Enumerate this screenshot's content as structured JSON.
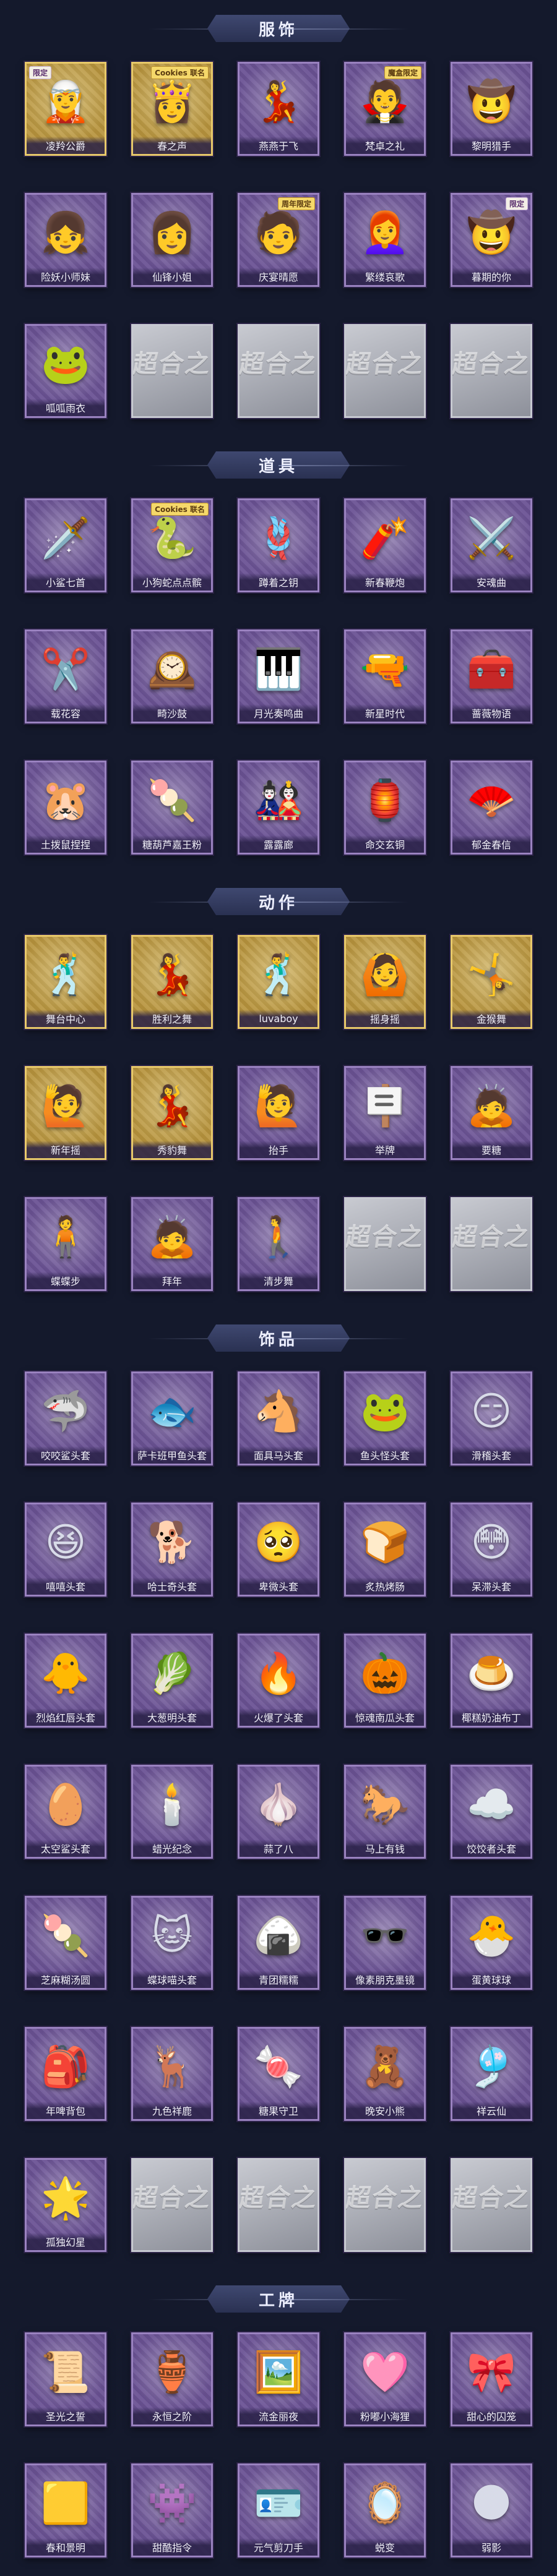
{
  "sections": [
    {
      "title": "服饰",
      "items": [
        {
          "label": "凌羚公爵",
          "icon": "costume-portrait",
          "glyph": "🧝",
          "tier": "gold",
          "badge": "限定"
        },
        {
          "label": "春之声",
          "icon": "costume-portrait",
          "glyph": "👸",
          "tier": "gold",
          "badge": "Cookies\n联名"
        },
        {
          "label": "燕燕于飞",
          "icon": "costume-portrait",
          "glyph": "💃",
          "tier": "purple"
        },
        {
          "label": "梵卓之礼",
          "icon": "costume-portrait",
          "glyph": "🧛",
          "tier": "purple",
          "badge": "魔盒限定"
        },
        {
          "label": "黎明猎手",
          "icon": "costume-portrait",
          "glyph": "🤠",
          "tier": "purple"
        },
        {
          "label": "险妖小师妹",
          "icon": "costume-portrait",
          "glyph": "👧",
          "tier": "purple"
        },
        {
          "label": "仙锋小姐",
          "icon": "costume-portrait",
          "glyph": "👩",
          "tier": "purple"
        },
        {
          "label": "庆宴晴愿",
          "icon": "costume-portrait",
          "glyph": "🧑",
          "tier": "purple",
          "badge": "周年限定"
        },
        {
          "label": "繁缕哀歌",
          "icon": "costume-portrait",
          "glyph": "👩‍🦰",
          "tier": "purple"
        },
        {
          "label": "暮期的你",
          "icon": "costume-portrait",
          "glyph": "🤠",
          "tier": "purple",
          "badge": "限定"
        },
        {
          "label": "呱呱雨衣",
          "icon": "costume-portrait",
          "glyph": "🐸",
          "tier": "purple"
        },
        {
          "label": "",
          "icon": "placeholder-card",
          "glyph": "超合之",
          "tier": "gray"
        },
        {
          "label": "",
          "icon": "placeholder-card",
          "glyph": "超合之",
          "tier": "gray"
        },
        {
          "label": "",
          "icon": "placeholder-card",
          "glyph": "超合之",
          "tier": "gray"
        },
        {
          "label": "",
          "icon": "placeholder-card",
          "glyph": "超合之",
          "tier": "gray"
        }
      ]
    },
    {
      "title": "道具",
      "items": [
        {
          "label": "小鲨七首",
          "icon": "dagger-icon",
          "glyph": "🗡️",
          "tier": "purple"
        },
        {
          "label": "小狗蛇点点髌",
          "icon": "pet-prop-icon",
          "glyph": "🐍",
          "tier": "purple",
          "badge": "Cookies\n联名"
        },
        {
          "label": "蹲着之钥",
          "icon": "whip-icon",
          "glyph": "🪢",
          "tier": "purple"
        },
        {
          "label": "新春鞭炮",
          "icon": "firecracker-icon",
          "glyph": "🧨",
          "tier": "purple"
        },
        {
          "label": "安魂曲",
          "icon": "sword-icon",
          "glyph": "⚔️",
          "tier": "purple"
        },
        {
          "label": "载花容",
          "icon": "scissors-icon",
          "glyph": "✂️",
          "tier": "purple"
        },
        {
          "label": "畸沙鼓",
          "icon": "pendulum-icon",
          "glyph": "🕰️",
          "tier": "purple"
        },
        {
          "label": "月光奏鸣曲",
          "icon": "piano-icon",
          "glyph": "🎹",
          "tier": "purple"
        },
        {
          "label": "新星时代",
          "icon": "revolver-icon",
          "glyph": "🔫",
          "tier": "purple"
        },
        {
          "label": "蔷薇物语",
          "icon": "medkit-icon",
          "glyph": "🧰",
          "tier": "purple"
        },
        {
          "label": "土拨鼠捏捏",
          "icon": "plush-icon",
          "glyph": "🐹",
          "tier": "purple"
        },
        {
          "label": "糖葫芦嘉王粉",
          "icon": "candied-stick-icon",
          "glyph": "🍡",
          "tier": "purple"
        },
        {
          "label": "露露廊",
          "icon": "doll-icon",
          "glyph": "🎎",
          "tier": "purple"
        },
        {
          "label": "命交玄铜",
          "icon": "lantern-icon",
          "glyph": "🏮",
          "tier": "purple"
        },
        {
          "label": "郁金春信",
          "icon": "fan-icon",
          "glyph": "🪭",
          "tier": "purple"
        }
      ]
    },
    {
      "title": "动作",
      "items": [
        {
          "label": "舞台中心",
          "icon": "pose-figure-icon",
          "glyph": "🕺",
          "tier": "gold"
        },
        {
          "label": "胜利之舞",
          "icon": "pose-figure-icon",
          "glyph": "💃",
          "tier": "gold"
        },
        {
          "label": "luvaboy",
          "icon": "pose-figure-icon",
          "glyph": "🕺",
          "tier": "gold"
        },
        {
          "label": "摇身摇",
          "icon": "pose-figure-icon",
          "glyph": "🙆",
          "tier": "gold"
        },
        {
          "label": "金猴舞",
          "icon": "pose-figure-icon",
          "glyph": "🤸",
          "tier": "gold"
        },
        {
          "label": "新年摇",
          "icon": "pose-figure-icon",
          "glyph": "🙋",
          "tier": "gold"
        },
        {
          "label": "秀豹舞",
          "icon": "pose-figure-icon",
          "glyph": "💃",
          "tier": "gold"
        },
        {
          "label": "抬手",
          "icon": "pose-figure-icon",
          "glyph": "🙋",
          "tier": "purple"
        },
        {
          "label": "举牌",
          "icon": "pose-figure-icon",
          "glyph": "🪧",
          "tier": "purple"
        },
        {
          "label": "要糖",
          "icon": "pose-figure-icon",
          "glyph": "🙇",
          "tier": "purple"
        },
        {
          "label": "蝶蝶步",
          "icon": "pose-figure-icon",
          "glyph": "🧍",
          "tier": "purple"
        },
        {
          "label": "拜年",
          "icon": "pose-figure-icon",
          "glyph": "🙇",
          "tier": "purple"
        },
        {
          "label": "清步舞",
          "icon": "pose-figure-icon",
          "glyph": "🚶",
          "tier": "purple"
        },
        {
          "label": "",
          "icon": "placeholder-card",
          "glyph": "超合之",
          "tier": "gray"
        },
        {
          "label": "",
          "icon": "placeholder-card",
          "glyph": "超合之",
          "tier": "gray"
        }
      ]
    },
    {
      "title": "饰品",
      "items": [
        {
          "label": "咬咬鲨头套",
          "icon": "shark-head-icon",
          "glyph": "🦈",
          "tier": "purple"
        },
        {
          "label": "萨卡班甲鱼头套",
          "icon": "fish-head-icon",
          "glyph": "🐟",
          "tier": "purple"
        },
        {
          "label": "面具马头套",
          "icon": "horse-head-icon",
          "glyph": "🐴",
          "tier": "purple"
        },
        {
          "label": "鱼头怪头套",
          "icon": "frog-head-icon",
          "glyph": "🐸",
          "tier": "purple"
        },
        {
          "label": "滑稽头套",
          "icon": "smile-head-icon",
          "glyph": "😏",
          "tier": "purple"
        },
        {
          "label": "嘻嘻头套",
          "icon": "grin-head-icon",
          "glyph": "😆",
          "tier": "purple"
        },
        {
          "label": "哈士奇头套",
          "icon": "dog-head-icon",
          "glyph": "🐕",
          "tier": "purple"
        },
        {
          "label": "卑微头套",
          "icon": "sad-head-icon",
          "glyph": "🥺",
          "tier": "purple"
        },
        {
          "label": "炙热烤肠",
          "icon": "toast-head-icon",
          "glyph": "🍞",
          "tier": "purple"
        },
        {
          "label": "呆滞头套",
          "icon": "stare-head-icon",
          "glyph": "😳",
          "tier": "purple"
        },
        {
          "label": "烈焰红唇头套",
          "icon": "lips-head-icon",
          "glyph": "🐥",
          "tier": "purple"
        },
        {
          "label": "大葱明头套",
          "icon": "bokchoy-head-icon",
          "glyph": "🥬",
          "tier": "purple"
        },
        {
          "label": "火爆了头套",
          "icon": "fire-head-icon",
          "glyph": "🔥",
          "tier": "purple"
        },
        {
          "label": "惊魂南瓜头套",
          "icon": "pumpkin-head-icon",
          "glyph": "🎃",
          "tier": "purple"
        },
        {
          "label": "椰糕奶油布丁",
          "icon": "pudding-head-icon",
          "glyph": "🍮",
          "tier": "purple"
        },
        {
          "label": "太空鲨头套",
          "icon": "egg-head-icon",
          "glyph": "🥚",
          "tier": "purple"
        },
        {
          "label": "蜡光纪念",
          "icon": "candle-icon",
          "glyph": "🕯️",
          "tier": "purple"
        },
        {
          "label": "蒜了八",
          "icon": "garlic-head-icon",
          "glyph": "🧄",
          "tier": "purple"
        },
        {
          "label": "马上有钱",
          "icon": "horse-plush-icon",
          "glyph": "🐎",
          "tier": "purple"
        },
        {
          "label": "饺饺者头套",
          "icon": "cloud-head-icon",
          "glyph": "☁️",
          "tier": "purple"
        },
        {
          "label": "芝麻糊汤圆",
          "icon": "dumpling-head-icon",
          "glyph": "🍡",
          "tier": "purple"
        },
        {
          "label": "蝶球喵头套",
          "icon": "cat-head-icon",
          "glyph": "🐱",
          "tier": "purple"
        },
        {
          "label": "青团糯糯",
          "icon": "riceball-head-icon",
          "glyph": "🍙",
          "tier": "purple"
        },
        {
          "label": "像素朋克墨镜",
          "icon": "pixel-glasses-icon",
          "glyph": "🕶️",
          "tier": "purple"
        },
        {
          "label": "蛋黄球球",
          "icon": "yolk-head-icon",
          "glyph": "🐣",
          "tier": "purple"
        },
        {
          "label": "年啤背包",
          "icon": "bag-charm-icon",
          "glyph": "🎒",
          "tier": "purple"
        },
        {
          "label": "九色祥鹿",
          "icon": "deer-charm-icon",
          "glyph": "🦌",
          "tier": "purple"
        },
        {
          "label": "糖果守卫",
          "icon": "lantern-charm-icon",
          "glyph": "🍬",
          "tier": "purple"
        },
        {
          "label": "晚安小熊",
          "icon": "bear-charm-icon",
          "glyph": "🧸",
          "tier": "purple"
        },
        {
          "label": "祥云仙",
          "icon": "cloud-charm-icon",
          "glyph": "🎐",
          "tier": "purple"
        },
        {
          "label": "孤独幻星",
          "icon": "star-charm-icon",
          "glyph": "🌟",
          "tier": "purple"
        },
        {
          "label": "",
          "icon": "placeholder-card",
          "glyph": "超合之",
          "tier": "gray"
        },
        {
          "label": "",
          "icon": "placeholder-card",
          "glyph": "超合之",
          "tier": "gray"
        },
        {
          "label": "",
          "icon": "placeholder-card",
          "glyph": "超合之",
          "tier": "gray"
        },
        {
          "label": "",
          "icon": "placeholder-card",
          "glyph": "超合之",
          "tier": "gray"
        }
      ]
    },
    {
      "title": "工牌",
      "items": [
        {
          "label": "圣光之誓",
          "icon": "badge-frame-icon",
          "glyph": "📜",
          "tier": "purple"
        },
        {
          "label": "永恒之阶",
          "icon": "badge-frame-icon",
          "glyph": "🏺",
          "tier": "purple"
        },
        {
          "label": "流金丽夜",
          "icon": "badge-frame-icon",
          "glyph": "🖼️",
          "tier": "purple"
        },
        {
          "label": "粉嘟小海狸",
          "icon": "badge-frame-icon",
          "glyph": "🩷",
          "tier": "purple"
        },
        {
          "label": "甜心的囚笼",
          "icon": "badge-frame-icon",
          "glyph": "🎀",
          "tier": "purple"
        },
        {
          "label": "春和景明",
          "icon": "badge-frame-icon",
          "glyph": "🟨",
          "tier": "purple"
        },
        {
          "label": "甜酷指令",
          "icon": "badge-frame-icon",
          "glyph": "👾",
          "tier": "purple"
        },
        {
          "label": "元气剪刀手",
          "icon": "badge-frame-icon",
          "glyph": "🪪",
          "tier": "purple"
        },
        {
          "label": "蜕变",
          "icon": "badge-frame-icon",
          "glyph": "🪞",
          "tier": "purple"
        },
        {
          "label": "弱影",
          "icon": "badge-frame-icon",
          "glyph": "🌑",
          "tier": "purple"
        }
      ]
    }
  ]
}
